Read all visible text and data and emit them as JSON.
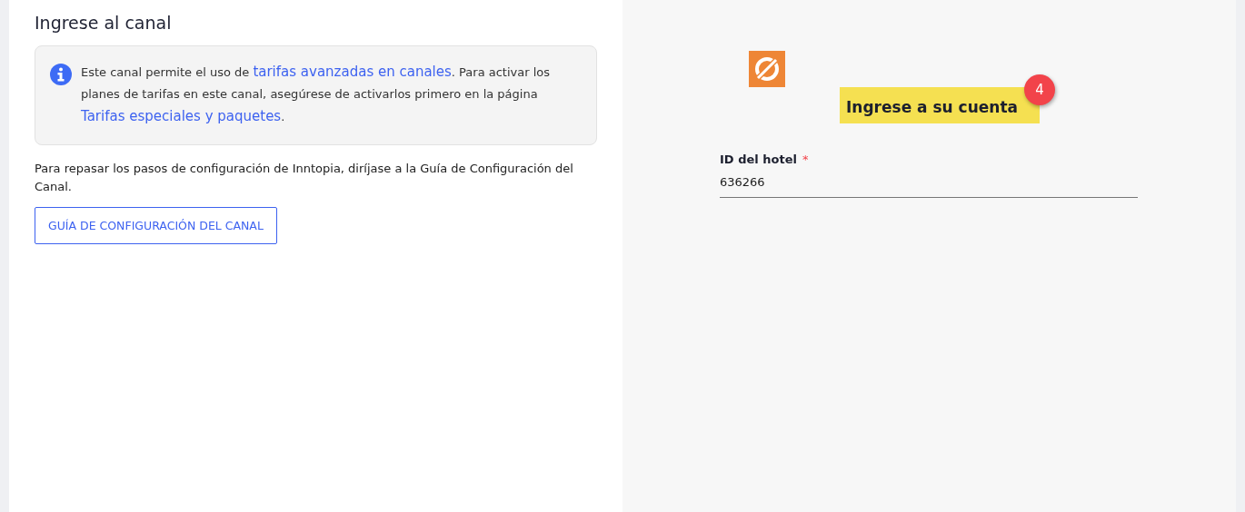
{
  "left_panel": {
    "title": "Ingrese al canal",
    "info": {
      "segments": [
        {
          "kind": "text",
          "text": "Este canal permite el uso de "
        },
        {
          "kind": "link",
          "text": "tarifas avanzadas en canales"
        },
        {
          "kind": "text",
          "text": ". Para activar los planes de tarifas en este canal, asegúrese de activarlos primero en la página "
        },
        {
          "kind": "link",
          "text": "Tarifas especiales y paquetes"
        },
        {
          "kind": "text",
          "text": "."
        }
      ]
    },
    "guide_text": "Para repasar los pasos de configuración de Inntopia, diríjase a la Guía de Configuración del Canal.",
    "guide_button": "GUÍA DE CONFIGURACIÓN DEL CANAL"
  },
  "right_panel": {
    "heading": "Ingrese a su cuenta",
    "step_badge": "4",
    "field": {
      "label": "ID del hotel",
      "required_mark": "*",
      "value": "636266"
    }
  }
}
